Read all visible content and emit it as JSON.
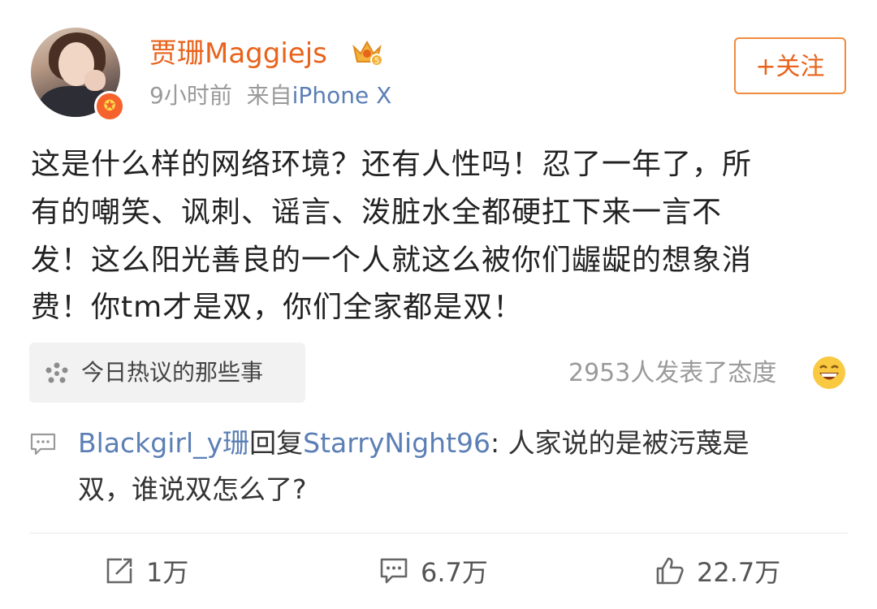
{
  "post": {
    "author": "贾珊Maggiejs",
    "time": "9小时前",
    "source_prefix": "来自",
    "source": "iPhone X",
    "follow_label": "+关注",
    "text_lines": [
      "这是什么样的网络环境？还有人性吗！忍了一年了，所",
      "有的嘲笑、讽刺、谣言、泼脏水全都硬扛下来一言不",
      "发！这么阳光善良的一个人就这么被你们龌龊的想象消",
      "费！你tm才是双，你们全家都是双！"
    ],
    "topic": "今日热议的那些事",
    "attitude_count": "2953人发表了态度"
  },
  "comment": {
    "user": "Blackgirl_y珊",
    "reply_word": "回复",
    "reply_to": "StarryNight96",
    "text_part1": ": 人家说的是被污蔑是",
    "text_part2": "双，谁说双怎么了?"
  },
  "actions": {
    "repost_count": "1万",
    "comment_count": "6.7万",
    "like_count": "22.7万"
  },
  "colors": {
    "accent": "#e8631c",
    "link": "#5b7fb5",
    "muted": "#9a9a9a"
  }
}
